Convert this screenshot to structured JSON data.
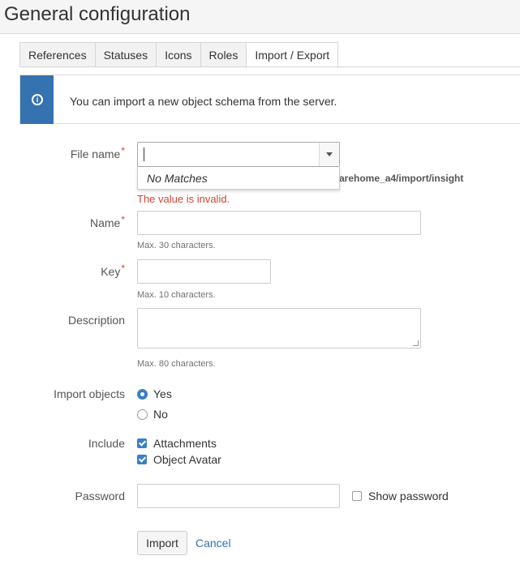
{
  "page": {
    "title": "General configuration"
  },
  "tabs": [
    {
      "label": "References",
      "active": false
    },
    {
      "label": "Statuses",
      "active": false
    },
    {
      "label": "Icons",
      "active": false
    },
    {
      "label": "Roles",
      "active": false
    },
    {
      "label": "Import / Export",
      "active": true
    }
  ],
  "info": {
    "icon": "info-icon",
    "text": "You can import a new object schema from the server."
  },
  "form": {
    "required_mark": "*",
    "file_name": {
      "label": "File name",
      "value": "",
      "dropdown_text": "No Matches",
      "path_text": "arehome_a4/import/insight",
      "error": "The value is invalid."
    },
    "name": {
      "label": "Name",
      "value": "",
      "hint": "Max. 30 characters."
    },
    "key": {
      "label": "Key",
      "value": "",
      "hint": "Max. 10 characters."
    },
    "description": {
      "label": "Description",
      "value": "",
      "hint": "Max. 80 characters."
    },
    "import_objects": {
      "label": "Import objects",
      "options": [
        {
          "label": "Yes",
          "selected": true
        },
        {
          "label": "No",
          "selected": false
        }
      ]
    },
    "include": {
      "label": "Include",
      "options": [
        {
          "label": "Attachments",
          "checked": true
        },
        {
          "label": "Object Avatar",
          "checked": true
        }
      ]
    },
    "password": {
      "label": "Password",
      "value": "",
      "show_password_label": "Show password",
      "show_password_checked": false
    }
  },
  "actions": {
    "import_label": "Import",
    "cancel_label": "Cancel"
  },
  "colors": {
    "accent": "#3572b0",
    "error": "#d04437",
    "check": "#3b7fc4"
  }
}
